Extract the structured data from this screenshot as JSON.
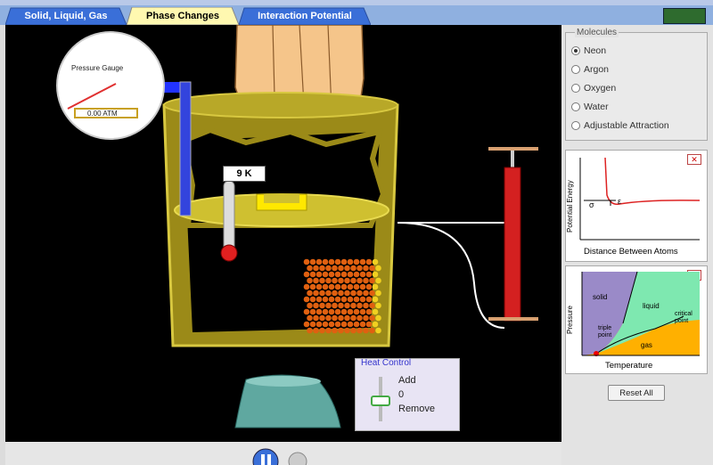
{
  "tabs": [
    {
      "label": "Solid, Liquid, Gas"
    },
    {
      "label": "Phase Changes"
    },
    {
      "label": "Interaction Potential"
    }
  ],
  "gauge": {
    "title": "Pressure Gauge",
    "value": "0.00 ATM"
  },
  "thermometer": {
    "value": "9",
    "unit": "K"
  },
  "heat_control": {
    "title": "Heat Control",
    "add": "Add",
    "zero": "0",
    "remove": "Remove",
    "level": 0.5
  },
  "molecules": {
    "title": "Molecules",
    "options": [
      {
        "label": "Neon",
        "selected": true
      },
      {
        "label": "Argon",
        "selected": false
      },
      {
        "label": "Oxygen",
        "selected": false
      },
      {
        "label": "Water",
        "selected": false
      },
      {
        "label": "Adjustable Attraction",
        "selected": false
      }
    ]
  },
  "potential_chart": {
    "ylabel": "Potential Energy",
    "xlabel": "Distance Between Atoms",
    "sigma": "σ",
    "eps": "ε"
  },
  "phase_chart": {
    "ylabel": "Pressure",
    "xlabel": "Temperature",
    "solid": "solid",
    "liquid": "liquid",
    "gas": "gas",
    "triple": "triple point",
    "critical": "critical point"
  },
  "reset_label": "Reset All",
  "colors": {
    "tab_bg": "#8fb0e0",
    "tab_selected": "#fff8b0",
    "container": "#c8b020",
    "pump": "#cc2222",
    "molecule": "#e06010"
  }
}
